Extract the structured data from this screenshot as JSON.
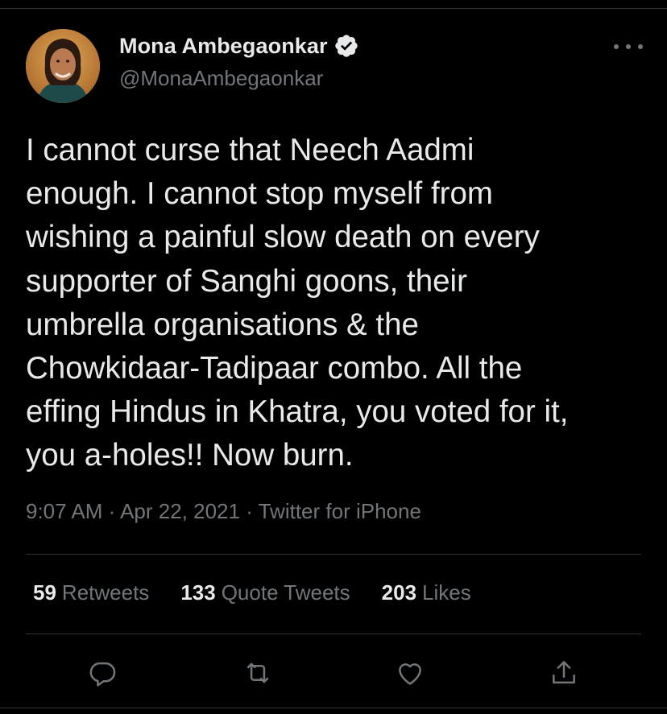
{
  "author": {
    "display_name": "Mona Ambegaonkar",
    "handle": "@MonaAmbegaonkar",
    "verified": true
  },
  "tweet": {
    "text_lines": [
      "I cannot curse that Neech Aadmi",
      "enough. I cannot stop myself from",
      "wishing a painful slow death on every",
      "supporter of Sanghi goons, their",
      "umbrella organisations & the",
      "Chowkidaar-Tadipaar combo. All the",
      "effing Hindus in Khatra, you voted for it,",
      "you a-holes!! Now burn."
    ],
    "time": "9:07 AM",
    "date": "Apr 22, 2021",
    "source": "Twitter for iPhone",
    "separator": " · "
  },
  "stats": {
    "retweets": {
      "count": "59",
      "label": "Retweets"
    },
    "quote_tweets": {
      "count": "133",
      "label": "Quote Tweets"
    },
    "likes": {
      "count": "203",
      "label": "Likes"
    }
  },
  "icons": {
    "more": "more-icon",
    "verified": "verified-badge-icon",
    "reply": "reply-icon",
    "retweet": "retweet-icon",
    "like": "heart-icon",
    "share": "share-icon"
  },
  "colors": {
    "background": "#000000",
    "text_primary": "#e7e9ea",
    "text_secondary": "#71767b",
    "divider": "#2f3336",
    "verified_badge": "#e7e9ea"
  }
}
